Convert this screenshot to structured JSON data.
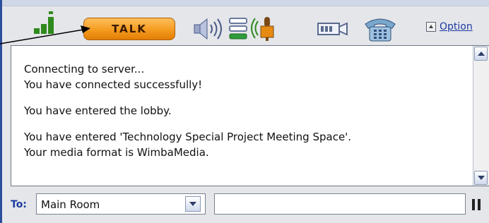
{
  "toolbar": {
    "talk_label": "TALK",
    "options_label": "Option"
  },
  "messages": [
    [
      "Connecting to server...",
      "You have connected successfully!"
    ],
    [
      "You have entered the lobby."
    ],
    [
      "You have entered 'Technology Special Project Meeting Space'.",
      "Your media format is WimbaMedia."
    ]
  ],
  "message_lines": {
    "m0": "Connecting to server...",
    "m1": "You have connected successfully!",
    "m2": "You have entered the lobby.",
    "m3": "You have entered 'Technology Special Project Meeting Space'.",
    "m4": "Your media format is WimbaMedia."
  },
  "recipient": {
    "label": "To:",
    "value": "Main Room"
  },
  "chat_input": {
    "value": ""
  },
  "icons": {
    "signal": "signal-strength-icon",
    "speaker": "speaker-volume-icon",
    "status": "status-bars-icon",
    "mic": "microphone-broadcast-icon",
    "camera": "video-camera-icon",
    "phone": "telephone-icon"
  },
  "colors": {
    "talk_button": "#f59b1f",
    "link": "#1c3ba0",
    "signal_green": "#2f8a1c",
    "frame_blue": "#2d4e9c"
  }
}
